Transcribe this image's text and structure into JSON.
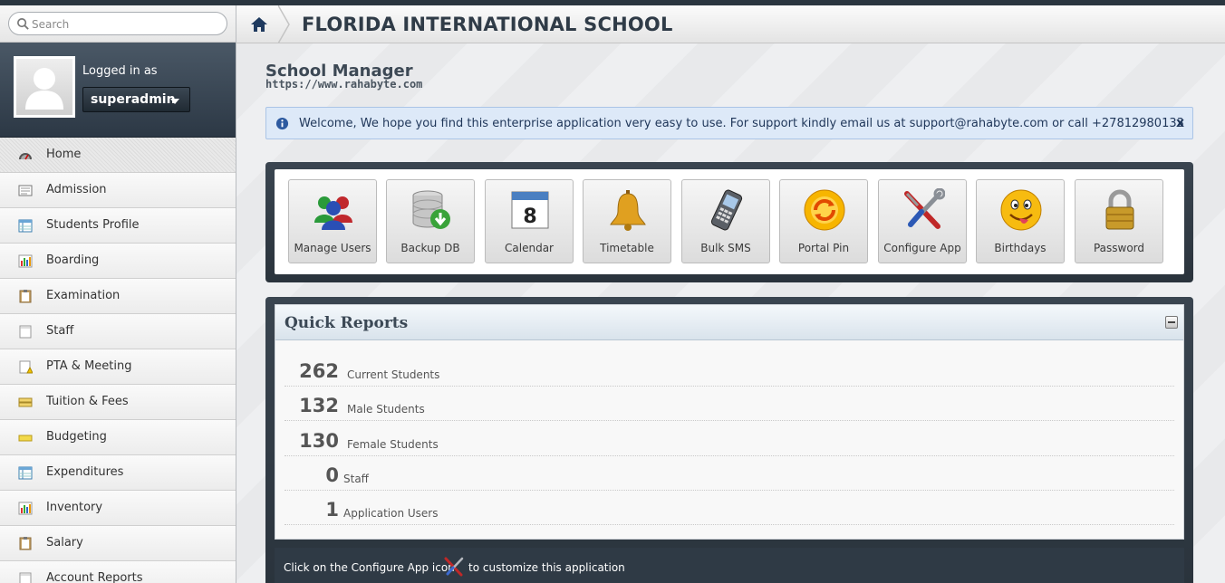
{
  "search": {
    "placeholder": "Search"
  },
  "user": {
    "logged_in_label": "Logged in as",
    "username": "superadmin"
  },
  "sidebar": {
    "items": [
      {
        "label": "Home",
        "icon": "dashboard-gauge-icon",
        "active": true
      },
      {
        "label": "Admission",
        "icon": "form-icon"
      },
      {
        "label": "Students Profile",
        "icon": "table-icon"
      },
      {
        "label": "Boarding",
        "icon": "bar-chart-icon"
      },
      {
        "label": "Examination",
        "icon": "clipboard-icon"
      },
      {
        "label": "Staff",
        "icon": "document-icon"
      },
      {
        "label": "PTA & Meeting",
        "icon": "warning-document-icon"
      },
      {
        "label": "Tuition & Fees",
        "icon": "money-icon"
      },
      {
        "label": "Budgeting",
        "icon": "folder-icon"
      },
      {
        "label": "Expenditures",
        "icon": "table-icon"
      },
      {
        "label": "Inventory",
        "icon": "bar-chart-icon"
      },
      {
        "label": "Salary",
        "icon": "clipboard-icon"
      },
      {
        "label": "Account Reports",
        "icon": "document-icon"
      }
    ]
  },
  "header": {
    "title": "FLORIDA INTERNATIONAL SCHOOL",
    "home_icon": "home-icon"
  },
  "page": {
    "title": "School Manager",
    "url": "https://www.rahabyte.com"
  },
  "alert": {
    "text": "Welcome, We hope you find this enterprise application very easy to use. For support kindly email us at support@rahabyte.com or call +27812980133",
    "close": "x"
  },
  "shortcuts": [
    {
      "label": "Manage Users",
      "icon": "users-icon"
    },
    {
      "label": "Backup DB",
      "icon": "database-backup-icon"
    },
    {
      "label": "Calendar",
      "icon": "calendar-icon"
    },
    {
      "label": "Timetable",
      "icon": "bell-icon"
    },
    {
      "label": "Bulk SMS",
      "icon": "mobile-phone-icon"
    },
    {
      "label": "Portal Pin",
      "icon": "refresh-pin-icon"
    },
    {
      "label": "Configure App",
      "icon": "tools-icon"
    },
    {
      "label": "Birthdays",
      "icon": "smiley-icon"
    },
    {
      "label": "Password",
      "icon": "padlock-icon"
    }
  ],
  "calendar_icon_day": "8",
  "quick_reports": {
    "title": "Quick Reports",
    "rows": [
      {
        "value": "262",
        "label": "Current Students"
      },
      {
        "value": "132",
        "label": "Male Students"
      },
      {
        "value": "130",
        "label": "Female Students"
      },
      {
        "value": "0",
        "label": "Staff"
      },
      {
        "value": "1",
        "label": "Application Users"
      }
    ]
  },
  "footer": {
    "text_before": "Click on the Configure App icon",
    "text_after": "to customize this application"
  },
  "colors": {
    "sidebar_dark": "#2c3845",
    "panel_dark": "#2f3a45",
    "alert_bg": "#dde9f8",
    "title": "#2f3b47"
  }
}
